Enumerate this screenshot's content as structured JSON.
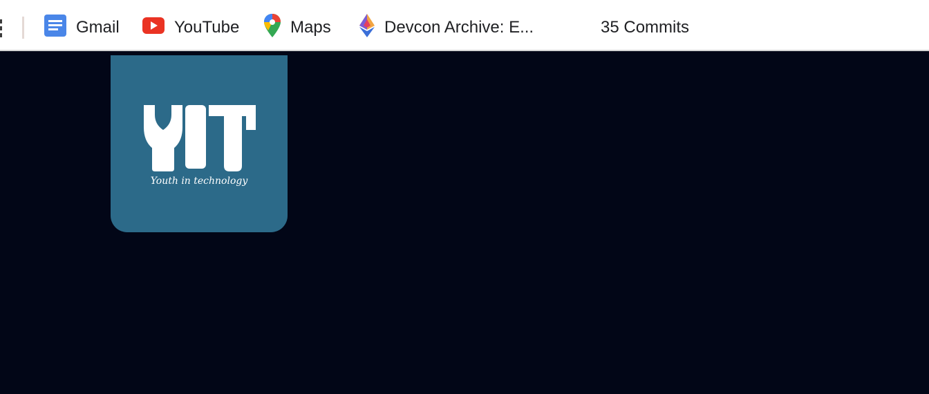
{
  "bookmarks_bar": {
    "apps_icon": "apps-grid-icon",
    "items": [
      {
        "label": "Gmail",
        "icon": "google-docs-icon"
      },
      {
        "label": "YouTube",
        "icon": "youtube-icon"
      },
      {
        "label": "Maps",
        "icon": "google-maps-pin-icon"
      },
      {
        "label": "Devcon Archive: E...",
        "icon": "ethereum-icon"
      },
      {
        "label": "35 Commits",
        "icon": ""
      }
    ]
  },
  "page": {
    "background_color": "#020617",
    "logo": {
      "monogram": "YIT",
      "tagline": "Youth in technology",
      "background_color": "#2c6a89"
    }
  }
}
